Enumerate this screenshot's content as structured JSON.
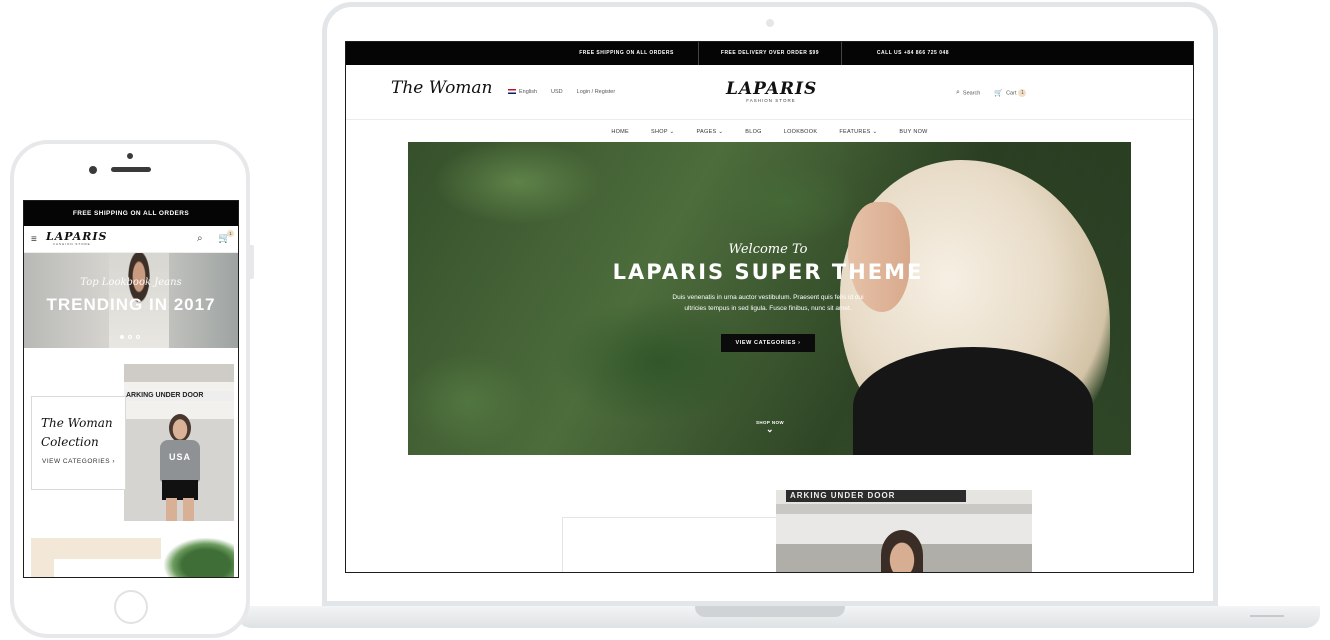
{
  "desktop": {
    "topbar": [
      "FREE SHIPPING ON ALL ORDERS",
      "FREE DELIVERY OVER ORDER $99",
      "CALL US +84 866 725 048"
    ],
    "header": {
      "language": "English",
      "currency": "USD",
      "account": "Login / Register",
      "search": "Search",
      "cart": "Cart",
      "cart_count": "1"
    },
    "logo": {
      "name": "LAPARIS",
      "tagline": "FASHION STORE"
    },
    "nav": [
      "HOME",
      "SHOP ⌄",
      "PAGES ⌄",
      "BLOG",
      "LOOKBOOK",
      "FEATURES ⌄",
      "BUY NOW"
    ],
    "hero": {
      "welcome": "Welcome To",
      "title": "LAPARIS SUPER THEME",
      "desc_line1": "Duis venenatis in urna auctor vestibulum. Praesent quis felis id dui",
      "desc_line2": "ultricies tempus in sed ligula. Fusce finibus, nunc sit amet.",
      "button": "VIEW CATEGORIES  ›",
      "shop_now": "SHOP NOW"
    },
    "collection": {
      "title": "The Woman",
      "sign": "ARKING UNDER DOOR"
    }
  },
  "mobile": {
    "topbar": "FREE SHIPPING ON ALL ORDERS",
    "logo": {
      "name": "LAPARIS",
      "tagline": "FASHION STORE"
    },
    "cart_count": "1",
    "hero": {
      "subtitle": "Top Lookbook Jeans",
      "title": "TRENDING IN 2017"
    },
    "collection": {
      "title_line1": "The Woman",
      "title_line2": "Colection",
      "link": "VIEW CATEGORIES  ›",
      "sign": "ARKING UNDER DOOR",
      "shirt_text": "USA"
    }
  },
  "icons": {
    "search": "⌕",
    "cart": "🛒",
    "menu": "≡",
    "chevron_down": "⌄"
  }
}
